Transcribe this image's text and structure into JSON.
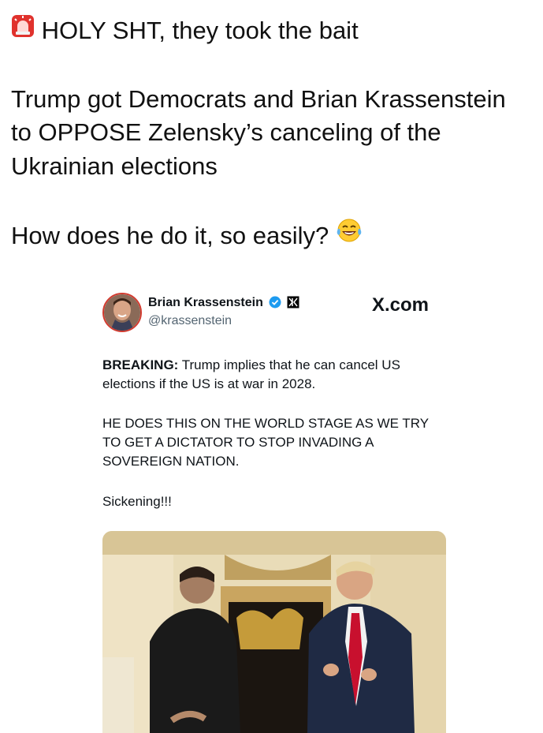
{
  "post": {
    "alert_emoji": "rotating-light-icon",
    "line1": "HOLY SHT, they took the bait",
    "line2": "Trump got Democrats and Brian Krassenstein",
    "line3": "to OPPOSE Zelensky’s canceling of the",
    "line4": "Ukrainian elections",
    "line5": "How does he do it, so easily?",
    "end_emoji": "tears-of-joy-icon"
  },
  "quoted_tweet": {
    "author_name": "Brian Krassenstein",
    "author_handle": "@krassenstein",
    "site_label": "X.com",
    "verified_badge": "verified-badge-icon",
    "affiliate_badge": "affiliate-logo-icon",
    "body": {
      "breaking_label": "BREAKING:",
      "line1_rest": " Trump implies that he can cancel US",
      "line2": "elections if the US is at war in 2028.",
      "line3": "HE DOES THIS ON THE WORLD STAGE AS WE TRY",
      "line4": "TO GET A DICTATOR TO STOP INVADING A",
      "line5": "SOVEREIGN NATION.",
      "line6": "Sickening!!!"
    },
    "media": "video-still-photo"
  },
  "colors": {
    "text": "#0f1419",
    "muted": "#536471",
    "verified_blue": "#1d9bf0",
    "tie_red": "#c8102e"
  }
}
